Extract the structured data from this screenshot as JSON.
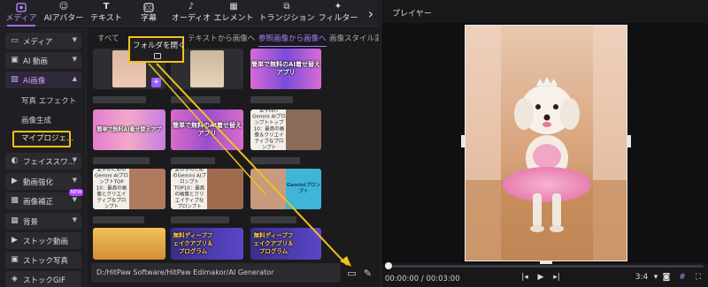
{
  "toolbar": {
    "items": [
      {
        "label": "メディア",
        "icon": "folder-media-icon"
      },
      {
        "label": "AIアバター",
        "icon": "ai-avatar-icon"
      },
      {
        "label": "テキスト",
        "icon": "text-icon"
      },
      {
        "label": "字幕",
        "icon": "subtitle-icon"
      },
      {
        "label": "オーディオ",
        "icon": "audio-icon"
      },
      {
        "label": "エレメント",
        "icon": "element-icon"
      },
      {
        "label": "トランジション",
        "icon": "transition-icon"
      },
      {
        "label": "フィルター",
        "icon": "filter-icon"
      }
    ],
    "more_glyph": "›"
  },
  "sidebar": {
    "items": [
      {
        "label": "メディア",
        "icon": "folder-icon"
      },
      {
        "label": "AI 動画",
        "icon": "ai-video-icon"
      },
      {
        "label": "AI画像",
        "icon": "ai-image-icon"
      },
      {
        "label": "フェイススワ...",
        "icon": "face-swap-icon"
      },
      {
        "label": "動画強化",
        "icon": "video-enhance-icon"
      },
      {
        "label": "画像補正",
        "icon": "image-fix-icon"
      },
      {
        "label": "背景",
        "icon": "background-icon"
      },
      {
        "label": "ストック動画",
        "icon": "stock-video-icon"
      },
      {
        "label": "ストック写真",
        "icon": "stock-photo-icon"
      },
      {
        "label": "ストックGIF",
        "icon": "stock-gif-icon"
      }
    ],
    "sub_items": [
      "写真 エフェクト",
      "画像生成",
      "マイプロジェ..."
    ],
    "new_badge": "NEW"
  },
  "tabs": [
    "すべて",
    "テキストから画像へ",
    "参照画像から画像へ",
    "画像スタイル変"
  ],
  "tooltip": "フォルダを開く",
  "thumb_captions": [
    "簡単で無料のAI着せ替えアプリ",
    "簡単で無料AI着せ替えアプ",
    "女子向けGemini AIプロンプトトップ10：最高の画像＆クリエイティブなプロンプト",
    "女子のためのGemini AIプロンプトTOP 10：最高の画像とクリエイティブなプロンプト",
    "女の子のためのGemini AIプロンプトTOP10：最高の画像とクリエイティブなプロンプト",
    "Geminiプロンプト",
    "無料ディープフェイクアプリ＆プログラム",
    "無料ディープフェイクアプリ＆プログラム"
  ],
  "path": "D:/HitPaw Software/HitPaw Edimakor/AI Generator",
  "player": {
    "title": "プレイヤー",
    "time": "00:00:00 / 00:03:00",
    "ratio": "3:4"
  },
  "colors": {
    "accent": "#a66bff",
    "highlight": "#f2c318"
  }
}
